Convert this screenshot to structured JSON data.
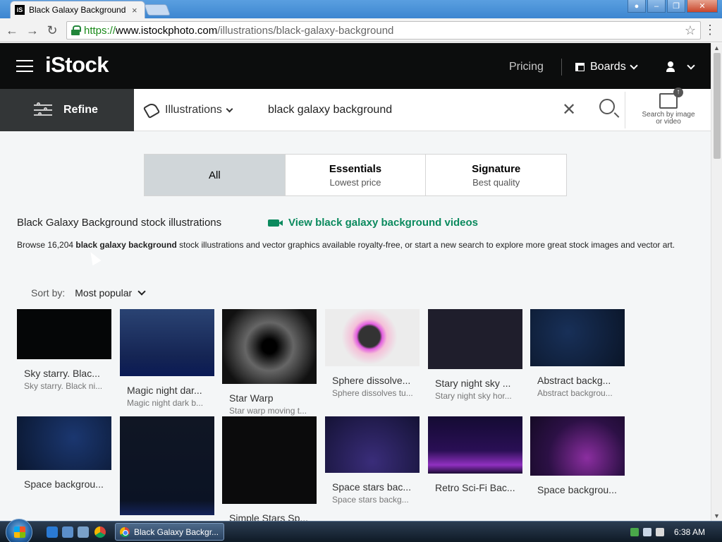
{
  "browser": {
    "tab_title": "Black Galaxy Background",
    "tab_favicon": "iS",
    "url_scheme": "https://",
    "url_host": "www.istockphoto.com",
    "url_path": "/illustrations/black-galaxy-background"
  },
  "header": {
    "logo": "iStock",
    "pricing": "Pricing",
    "boards": "Boards"
  },
  "search": {
    "refine": "Refine",
    "media_type": "Illustrations",
    "query": "black galaxy background",
    "search_by_image": "Search by image",
    "search_by_image_2": "or video"
  },
  "tabs": [
    {
      "main": "All",
      "sub": ""
    },
    {
      "main": "Essentials",
      "sub": "Lowest price"
    },
    {
      "main": "Signature",
      "sub": "Best quality"
    }
  ],
  "results": {
    "title": "Black Galaxy Background stock illustrations",
    "videos_link": "View black galaxy background videos",
    "desc_prefix": "Browse 16,204 ",
    "desc_bold": "black galaxy background",
    "desc_suffix": " stock illustrations and vector graphics available royalty-free, or start a new search to explore more great stock images and vector art."
  },
  "sort": {
    "label": "Sort by:",
    "value": "Most popular"
  },
  "images": [
    {
      "title": "Sky starry. Blac...",
      "sub": "Sky starry. Black ni...",
      "color": "#050607"
    },
    {
      "title": "Magic night dar...",
      "sub": "Magic night dark b...",
      "color": "#1f3566"
    },
    {
      "title": "Star Warp",
      "sub": "Star warp moving t...",
      "color": "#0a0a0a"
    },
    {
      "title": "Sphere dissolve...",
      "sub": "Sphere dissolves tu...",
      "color": "#e9e9ea"
    },
    {
      "title": "Stary night sky ...",
      "sub": "Stary night sky hor...",
      "color": "#1f1e2c"
    },
    {
      "title": "Abstract backg...",
      "sub": "Abstract backgrou...",
      "color": "#0e1d38"
    },
    {
      "title": "Space backgrou...",
      "sub": "",
      "color": "#0f2248"
    },
    {
      "title": "",
      "sub": "",
      "color": "#0d1220"
    },
    {
      "title": "Simple Stars Sp...",
      "sub": "",
      "color": "#0b0b0c"
    },
    {
      "title": "Space stars bac...",
      "sub": "Space stars backg...",
      "color": "#1e1b45"
    },
    {
      "title": "Retro Sci-Fi Bac...",
      "sub": "",
      "color": "#2a0f4a"
    },
    {
      "title": "Space backgrou...",
      "sub": "",
      "color": "#2c1045"
    }
  ],
  "taskbar": {
    "window_title": "Black Galaxy Backgr...",
    "clock": "6:38 AM"
  }
}
